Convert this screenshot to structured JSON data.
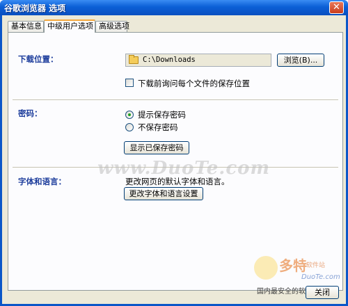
{
  "window": {
    "title": "谷歌浏览器 选项",
    "close_glyph": "✕"
  },
  "tabs": [
    {
      "label": "基本信息",
      "active": false
    },
    {
      "label": "中级用户选项",
      "active": true
    },
    {
      "label": "高级选项",
      "active": false
    }
  ],
  "download": {
    "label": "下载位置：",
    "path": "C:\\Downloads",
    "browse_label": "浏览(B)...",
    "ask_label": "下载前询问每个文件的保存位置",
    "ask_checked": false
  },
  "password": {
    "label": "密码：",
    "options": [
      {
        "label": "提示保存密码",
        "checked": true
      },
      {
        "label": "不保存密码",
        "checked": false
      }
    ],
    "show_button": "显示已保存密码"
  },
  "fonts": {
    "label": "字体和语言：",
    "desc": "更改网页的默认字体和语言。",
    "button": "更改字体和语言设置"
  },
  "watermark": {
    "text": "www.DuoTe.com"
  },
  "logo": {
    "main": "多特",
    "sub": "软件站",
    "url": "DuoTe.com"
  },
  "footer": {
    "note": "国内最安全的软件站",
    "close_label": "关闭"
  },
  "colors": {
    "title_bar": "#0b5fd6",
    "section_label": "#1d3d9c",
    "panel_bg": "#fcfcfe",
    "dialog_bg": "#ece9d8"
  }
}
